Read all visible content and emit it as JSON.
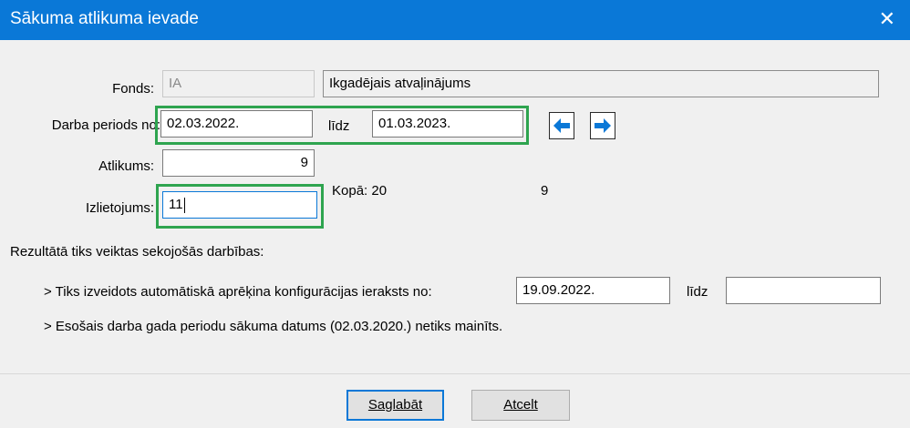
{
  "window": {
    "title": "Sākuma atlikuma ievade",
    "close_glyph": "✕"
  },
  "form": {
    "fonds": {
      "label": "Fonds:",
      "code": "IA",
      "name": "Ikgadējais atvaļinājums"
    },
    "period": {
      "label": "Darba periods no:",
      "from": "02.03.2022.",
      "to_label": "līdz",
      "to": "01.03.2023."
    },
    "nav": {
      "prev_icon": "arrow-left-icon",
      "next_icon": "arrow-right-icon"
    },
    "atlikums": {
      "label": "Atlikums:",
      "value": "9"
    },
    "izlietojums": {
      "label": "Izlietojums:",
      "value": "11"
    },
    "kopa": {
      "label": "Kopā: 20",
      "value": "9"
    }
  },
  "results": {
    "heading": "Rezultātā tiks veiktas sekojošās darbības:",
    "line1": "> Tiks izveidots automātiskā aprēķina konfigurācijas ieraksts no:",
    "line1_from": "19.09.2022.",
    "line1_to_label": "līdz",
    "line1_to": "",
    "line2": "> Esošais darba gada periodu sākuma datums (02.03.2020.) netiks mainīts."
  },
  "buttons": {
    "save_label": "Saglabāt",
    "cancel_label": "Atcelt"
  },
  "colors": {
    "titlebar": "#0a78d7",
    "highlight": "#2ea44f",
    "arrow": "#0a78d7"
  }
}
